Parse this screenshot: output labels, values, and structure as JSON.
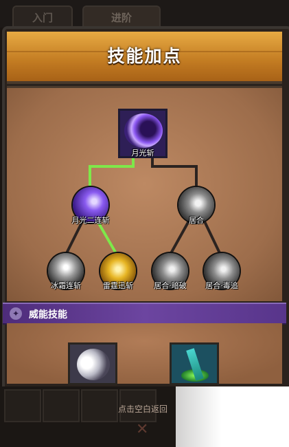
{
  "tabs": {
    "intro": "入门",
    "advanced": "进阶"
  },
  "title": "技能加点",
  "tree": {
    "root": {
      "label": "月光斩",
      "icon": "moon-slash-icon"
    },
    "level2": [
      {
        "label": "月光二连斩",
        "icon": "purple-orb-icon"
      },
      {
        "label": "居合",
        "icon": "grey-orb-icon"
      }
    ],
    "level3": [
      {
        "label": "冰霜连斩",
        "icon": "frost-orb-icon"
      },
      {
        "label": "雷霆迅斩",
        "icon": "thunder-orb-icon"
      },
      {
        "label": "居合·暗破",
        "icon": "grey-orb-icon"
      },
      {
        "label": "居合·毒追",
        "icon": "grey-orb-icon"
      }
    ],
    "colors": {
      "active_path": "#7ee84a",
      "inactive_path": "#2b2320"
    }
  },
  "section": {
    "title": "威能技能",
    "icon": "power-icon"
  },
  "footer": {
    "return_hint": "点击空白返回",
    "close_icon": "close-icon"
  }
}
